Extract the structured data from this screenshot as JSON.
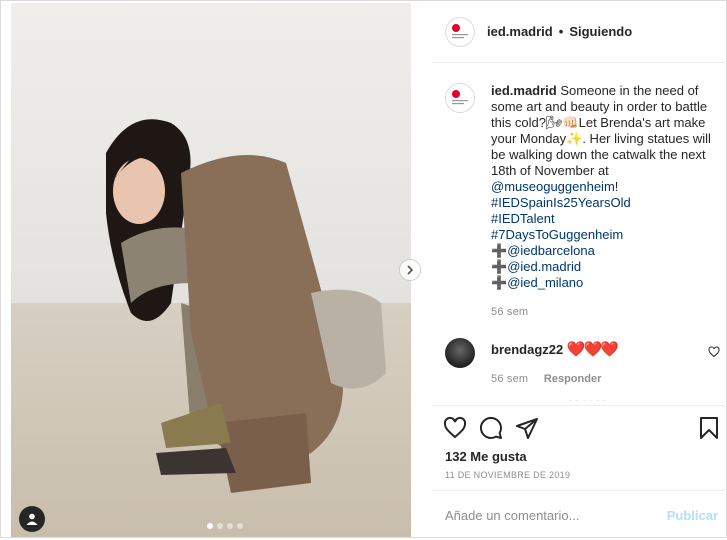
{
  "post": {
    "account": "ied.madrid",
    "separator": "•",
    "follow_state": "Siguiendo"
  },
  "caption": {
    "username": "ied.madrid",
    "line1": "Someone in the need of some art and beauty in order to battle this cold?🌬👊🏻Let Brenda's art make your Monday✨. Her living statues will be walking down the catwalk the next 18th of November at",
    "mention1": "@museoguggenheim",
    "after_mention1": "!",
    "hashtags": [
      "#IEDSpainIs25YearsOld",
      "#IEDTalent",
      "#7DaysToGuggenheim"
    ],
    "mentions": [
      {
        "prefix": "➕",
        "handle": "@iedbarcelona"
      },
      {
        "prefix": "➕",
        "handle": "@ied.madrid"
      },
      {
        "prefix": "➕",
        "handle": "@ied_milano"
      }
    ],
    "time": "56 sem"
  },
  "comment": {
    "username": "brendagz22",
    "text": "❤️❤️❤️",
    "time": "56 sem",
    "reply_label": "Responder"
  },
  "actions": {
    "likes": "132 Me gusta",
    "date": "11 DE NOVIEMBRE DE 2019",
    "comment_placeholder": "Añade un comentario...",
    "publish_label": "Publicar",
    "more_comments": "· · · · · ·"
  },
  "icons": {
    "like": "heart-icon",
    "comment": "comment-icon",
    "share": "share-icon",
    "save": "bookmark-icon",
    "next": "chevron-right-icon",
    "tag": "user-tag-icon"
  },
  "colors": {
    "link": "#00376b",
    "muted": "#8e8e8e",
    "publish_disabled": "#b2dffc",
    "heart": "#e0245e"
  },
  "carousel": {
    "slides": 4,
    "active": 1
  }
}
